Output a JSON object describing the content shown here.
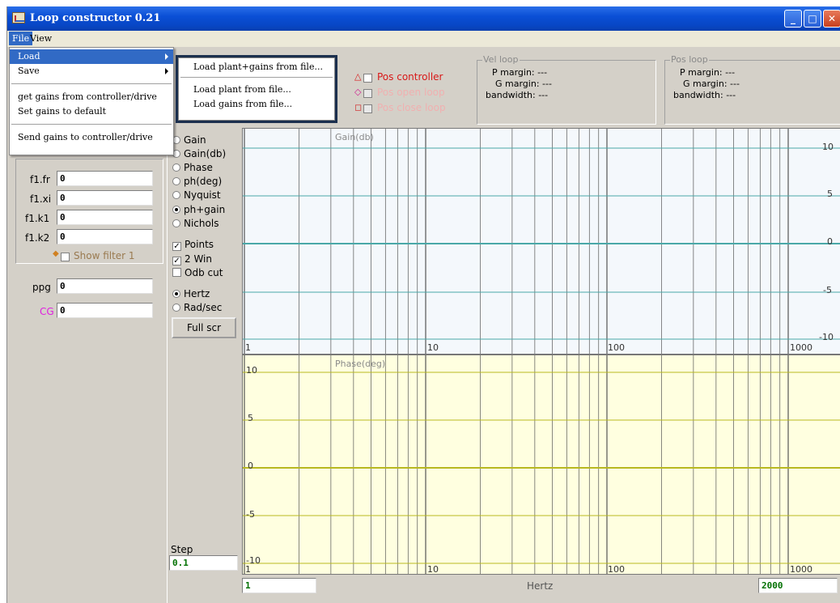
{
  "window": {
    "title": "Loop constructor 0.21"
  },
  "menubar": {
    "file": "File",
    "view": "View"
  },
  "file_menu": {
    "items": [
      "Load",
      "Save",
      "get gains from controller/drive",
      "Set gains to default",
      "Send gains to controller/drive"
    ]
  },
  "load_submenu": {
    "items": [
      "Load plant+gains from file...",
      "Load plant from file...",
      "Load gains from file..."
    ]
  },
  "filter": {
    "fr_label": "f1.fr",
    "fr_value": "0",
    "xi_label": "f1.xi",
    "xi_value": "0",
    "k1_label": "f1.k1",
    "k1_value": "0",
    "k2_label": "f1.k2",
    "k2_value": "0",
    "show_label": "Show filter 1"
  },
  "gains": {
    "ppg_label": "ppg",
    "ppg_value": "0",
    "cg_label": "CG",
    "cg_value": "0"
  },
  "options": {
    "gain": "Gain",
    "gain_db": "Gain(db)",
    "phase": "Phase",
    "ph_deg": "ph(deg)",
    "nyquist": "Nyquist",
    "ph_gain": "ph+gain",
    "nichols": "Nichols",
    "points": "Points",
    "two_win": "2 Win",
    "odb_cut": "Odb cut",
    "hertz": "Hertz",
    "rad_sec": "Rad/sec",
    "full_scr": "Full scr",
    "step_label": "Step",
    "step_value": "0.1"
  },
  "loops": {
    "pos_controller": "Pos controller",
    "pos_open_loop": "Pos open loop",
    "pos_close_loop": "Pos close loop",
    "vel_title": "Vel loop",
    "vel_p": "P margin: ---",
    "vel_g": "G margin: ---",
    "vel_bw": "bandwidth: ---",
    "pos_title": "Pos loop",
    "pos_p": "P margin: ---",
    "pos_g": "G margin: ---",
    "pos_bw": "bandwidth: ---"
  },
  "gain_plot": {
    "title": "Gain(db)",
    "y_ticks": [
      "10",
      "5",
      "0",
      "-5",
      "-10"
    ],
    "x_ticks": [
      "1",
      "10",
      "100",
      "1000"
    ]
  },
  "phase_plot": {
    "title": "Phase(deg)",
    "y_ticks": [
      "10",
      "5",
      "0",
      "-5",
      "-10"
    ],
    "x_ticks": [
      "1",
      "10",
      "100",
      "1000"
    ]
  },
  "xaxis": {
    "min": "1",
    "label": "Hertz",
    "max": "2000"
  },
  "colors": {
    "gain_bg": "#f4f8fc",
    "phase_bg": "#ffffe0",
    "gain_grid_h": "#4aa8a8",
    "phase_grid_h": "#b8b820",
    "grid_v": "#555555",
    "accent_red": "#d81818",
    "menu_select": "#316ac5"
  }
}
